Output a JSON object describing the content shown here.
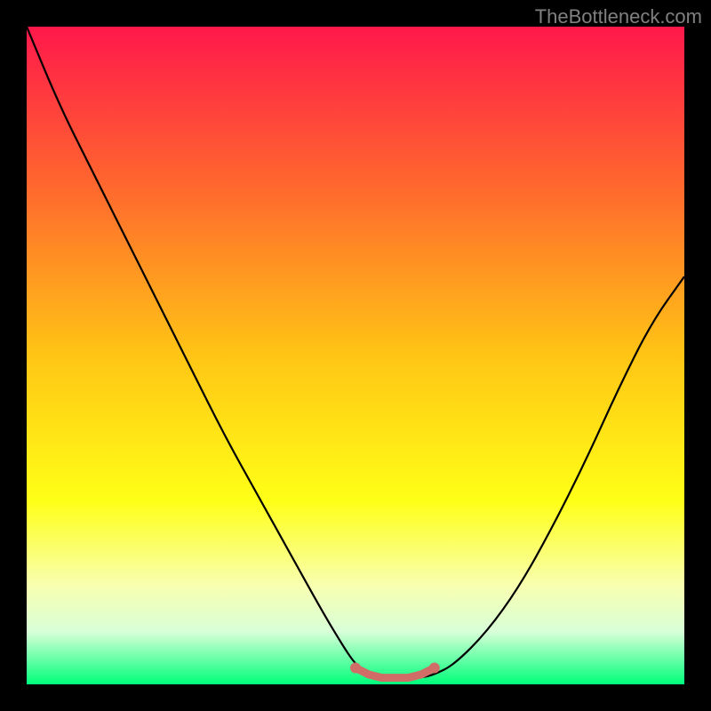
{
  "watermark": "TheBottleneck.com",
  "chart_data": {
    "type": "line",
    "title": "",
    "xlabel": "",
    "ylabel": "",
    "xlim": [
      0,
      100
    ],
    "ylim": [
      0,
      100
    ],
    "grid": false,
    "legend": false,
    "background_gradient": {
      "stops": [
        {
          "offset": 0,
          "color": "#ff184b"
        },
        {
          "offset": 25,
          "color": "#ff6a2d"
        },
        {
          "offset": 50,
          "color": "#ffc515"
        },
        {
          "offset": 72,
          "color": "#ffff16"
        },
        {
          "offset": 85,
          "color": "#f8ffb0"
        },
        {
          "offset": 92,
          "color": "#d8ffd8"
        },
        {
          "offset": 100,
          "color": "#00ff7a"
        }
      ]
    },
    "series": [
      {
        "name": "bottleneck-curve",
        "color": "#000000",
        "x": [
          0,
          5,
          10,
          15,
          20,
          25,
          30,
          35,
          40,
          45,
          48,
          50,
          52,
          55,
          58,
          60,
          62,
          65,
          70,
          75,
          80,
          85,
          90,
          95,
          100
        ],
        "y": [
          100,
          88,
          78,
          68,
          58,
          48,
          38,
          29,
          20,
          11,
          6,
          3,
          1.5,
          1,
          1,
          1,
          1.5,
          3,
          8,
          15,
          24,
          34,
          45,
          55,
          62
        ]
      },
      {
        "name": "optimal-zone",
        "color": "#cf6d66",
        "x": [
          50,
          52,
          54,
          56,
          58,
          60,
          62
        ],
        "y": [
          2.5,
          1.5,
          1,
          1,
          1,
          1.5,
          2.5
        ]
      }
    ]
  }
}
